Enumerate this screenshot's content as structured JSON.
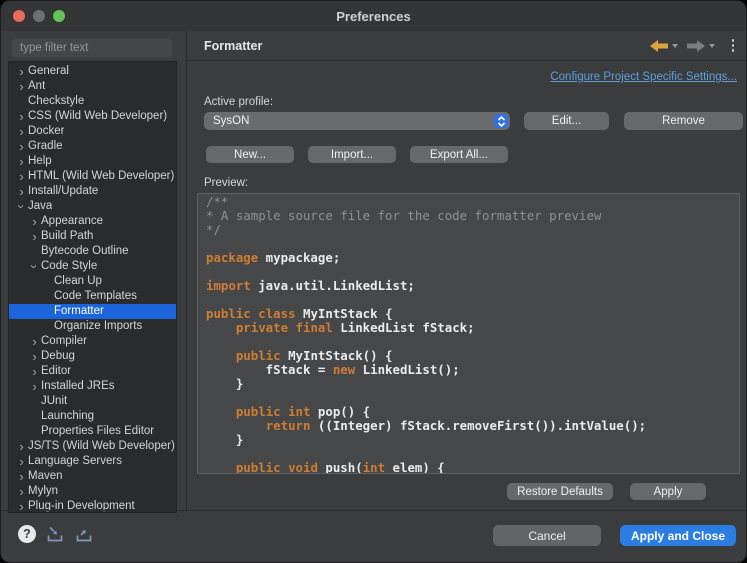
{
  "window": {
    "title": "Preferences"
  },
  "titlebar": {
    "buttons": [
      "close",
      "minimize",
      "zoom"
    ]
  },
  "sidebar": {
    "filter_placeholder": "type filter text",
    "tree": [
      {
        "label": "General",
        "level": 0,
        "expand": "collapsed"
      },
      {
        "label": "Ant",
        "level": 0,
        "expand": "collapsed"
      },
      {
        "label": "Checkstyle",
        "level": 0,
        "expand": "none"
      },
      {
        "label": "CSS (Wild Web Developer)",
        "level": 0,
        "expand": "collapsed"
      },
      {
        "label": "Docker",
        "level": 0,
        "expand": "collapsed"
      },
      {
        "label": "Gradle",
        "level": 0,
        "expand": "collapsed"
      },
      {
        "label": "Help",
        "level": 0,
        "expand": "collapsed"
      },
      {
        "label": "HTML (Wild Web Developer)",
        "level": 0,
        "expand": "collapsed"
      },
      {
        "label": "Install/Update",
        "level": 0,
        "expand": "collapsed"
      },
      {
        "label": "Java",
        "level": 0,
        "expand": "expanded"
      },
      {
        "label": "Appearance",
        "level": 1,
        "expand": "collapsed"
      },
      {
        "label": "Build Path",
        "level": 1,
        "expand": "collapsed"
      },
      {
        "label": "Bytecode Outline",
        "level": 1,
        "expand": "none"
      },
      {
        "label": "Code Style",
        "level": 1,
        "expand": "expanded"
      },
      {
        "label": "Clean Up",
        "level": 2,
        "expand": "none"
      },
      {
        "label": "Code Templates",
        "level": 2,
        "expand": "none"
      },
      {
        "label": "Formatter",
        "level": 2,
        "expand": "none",
        "selected": true
      },
      {
        "label": "Organize Imports",
        "level": 2,
        "expand": "none"
      },
      {
        "label": "Compiler",
        "level": 1,
        "expand": "collapsed"
      },
      {
        "label": "Debug",
        "level": 1,
        "expand": "collapsed"
      },
      {
        "label": "Editor",
        "level": 1,
        "expand": "collapsed"
      },
      {
        "label": "Installed JREs",
        "level": 1,
        "expand": "collapsed"
      },
      {
        "label": "JUnit",
        "level": 1,
        "expand": "none"
      },
      {
        "label": "Launching",
        "level": 1,
        "expand": "none"
      },
      {
        "label": "Properties Files Editor",
        "level": 1,
        "expand": "none"
      },
      {
        "label": "JS/TS (Wild Web Developer)",
        "level": 0,
        "expand": "collapsed"
      },
      {
        "label": "Language Servers",
        "level": 0,
        "expand": "collapsed"
      },
      {
        "label": "Maven",
        "level": 0,
        "expand": "collapsed"
      },
      {
        "label": "Mylyn",
        "level": 0,
        "expand": "collapsed"
      },
      {
        "label": "Plug-in Development",
        "level": 0,
        "expand": "collapsed"
      }
    ]
  },
  "content": {
    "page_title": "Formatter",
    "link_label": "Configure Project Specific Settings...",
    "active_profile_label": "Active profile:",
    "active_profile_value": "SysON",
    "buttons": {
      "edit": "Edit...",
      "remove": "Remove",
      "new": "New...",
      "import": "Import...",
      "export_all": "Export All...",
      "restore_defaults": "Restore Defaults",
      "apply": "Apply"
    },
    "preview_label": "Preview:",
    "preview_code": [
      [
        {
          "t": "c",
          "s": "/**"
        }
      ],
      [
        {
          "t": "c",
          "s": "* A sample source file for the code formatter preview"
        }
      ],
      [
        {
          "t": "c",
          "s": "*/"
        }
      ],
      [],
      [
        {
          "t": "k",
          "s": "package"
        },
        {
          "t": "p",
          "s": " mypackage;"
        }
      ],
      [],
      [
        {
          "t": "k",
          "s": "import"
        },
        {
          "t": "p",
          "s": " java.util.LinkedList;"
        }
      ],
      [],
      [
        {
          "t": "k",
          "s": "public"
        },
        {
          "t": "p",
          "s": " "
        },
        {
          "t": "k",
          "s": "class"
        },
        {
          "t": "p",
          "s": " MyIntStack {"
        }
      ],
      [
        {
          "t": "p",
          "s": "    "
        },
        {
          "t": "k",
          "s": "private"
        },
        {
          "t": "p",
          "s": " "
        },
        {
          "t": "k",
          "s": "final"
        },
        {
          "t": "p",
          "s": " LinkedList fStack;"
        }
      ],
      [],
      [
        {
          "t": "p",
          "s": "    "
        },
        {
          "t": "k",
          "s": "public"
        },
        {
          "t": "p",
          "s": " MyIntStack() {"
        }
      ],
      [
        {
          "t": "p",
          "s": "        fStack = "
        },
        {
          "t": "k",
          "s": "new"
        },
        {
          "t": "p",
          "s": " LinkedList();"
        }
      ],
      [
        {
          "t": "p",
          "s": "    }"
        }
      ],
      [],
      [
        {
          "t": "p",
          "s": "    "
        },
        {
          "t": "k",
          "s": "public"
        },
        {
          "t": "p",
          "s": " "
        },
        {
          "t": "k",
          "s": "int"
        },
        {
          "t": "p",
          "s": " pop() {"
        }
      ],
      [
        {
          "t": "p",
          "s": "        "
        },
        {
          "t": "k",
          "s": "return"
        },
        {
          "t": "p",
          "s": " ((Integer) fStack.removeFirst()).intValue();"
        }
      ],
      [
        {
          "t": "p",
          "s": "    }"
        }
      ],
      [],
      [
        {
          "t": "p",
          "s": "    "
        },
        {
          "t": "k",
          "s": "public"
        },
        {
          "t": "p",
          "s": " "
        },
        {
          "t": "k",
          "s": "void"
        },
        {
          "t": "p",
          "s": " push("
        },
        {
          "t": "k",
          "s": "int"
        },
        {
          "t": "p",
          "s": " elem) {"
        }
      ]
    ]
  },
  "footer": {
    "cancel_label": "Cancel",
    "apply_and_close_label": "Apply and Close"
  },
  "colors": {
    "selection_blue": "#1b64d9",
    "accent_blue": "#2b7de2",
    "link_blue": "#5f9fd8",
    "keyword_orange": "#cf7d33",
    "comment_gray": "#8e9194",
    "back_arrow_yellow": "#d9a53c"
  }
}
